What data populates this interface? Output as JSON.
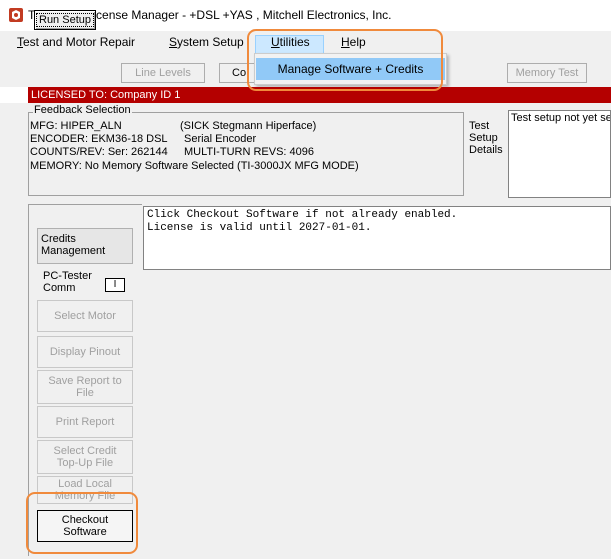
{
  "window": {
    "title": "TI-3000JX License Manager - +DSL +YAS , Mitchell Electronics, Inc."
  },
  "menu": {
    "items": [
      {
        "label": "Test and Motor Repair",
        "mnemonic": "T",
        "rest": "est and Motor Repair"
      },
      {
        "label": "System Setup",
        "mnemonic": "S",
        "rest": "ystem Setup"
      },
      {
        "label": "Utilities",
        "mnemonic": "U",
        "rest": "tilities"
      },
      {
        "label": "Help",
        "mnemonic": "H",
        "rest": "elp"
      }
    ],
    "dropdown_item": "Manage Software + Credits"
  },
  "toolbar": {
    "run_setup": "Run Setup",
    "line_levels": "Line Levels",
    "partial": "Co",
    "memory_test": "Memory Test"
  },
  "license": {
    "text": "LICENSED TO: Company ID 1"
  },
  "feedback": {
    "legend": "Feedback Selection",
    "mfg": "MFG: HIPER_ALN",
    "mfg_desc": "(SICK Stegmann Hiperface)",
    "encoder": "ENCODER: EKM36-18 DSL",
    "encoder_desc": "Serial Encoder",
    "counts": "COUNTS/REV: Ser: 262144",
    "multiturn": "MULTI-TURN REVS: 4096",
    "memory": "MEMORY: No Memory Software Selected   (TI-3000JX MFG MODE)"
  },
  "test_setup": {
    "label_line1": "Test",
    "label_line2": "Setup",
    "label_line3": "Details",
    "status": "Test setup not yet se"
  },
  "sidebar": {
    "credits_line1": "Credits",
    "credits_line2": "Management",
    "pc_line1": "PC-Tester",
    "pc_line2": "Comm",
    "pc_value": "I",
    "buttons": [
      {
        "line1": "Select Motor",
        "line2": ""
      },
      {
        "line1": "Display Pinout",
        "line2": ""
      },
      {
        "line1": "Save Report to",
        "line2": "File"
      },
      {
        "line1": "Print Report",
        "line2": ""
      },
      {
        "line1": "Select Credit",
        "line2": "Top-Up File"
      },
      {
        "line1": "Load Local",
        "line2": "Memory File"
      }
    ],
    "checkout_line1": "Checkout",
    "checkout_line2": "Software"
  },
  "messages": {
    "line1": "Click Checkout Software if not already enabled.",
    "line2": "License is valid until 2027-01-01."
  },
  "colors": {
    "license_bar": "#b40000",
    "highlight": "#f08a3c",
    "menu_selected": "#91c9f7"
  }
}
